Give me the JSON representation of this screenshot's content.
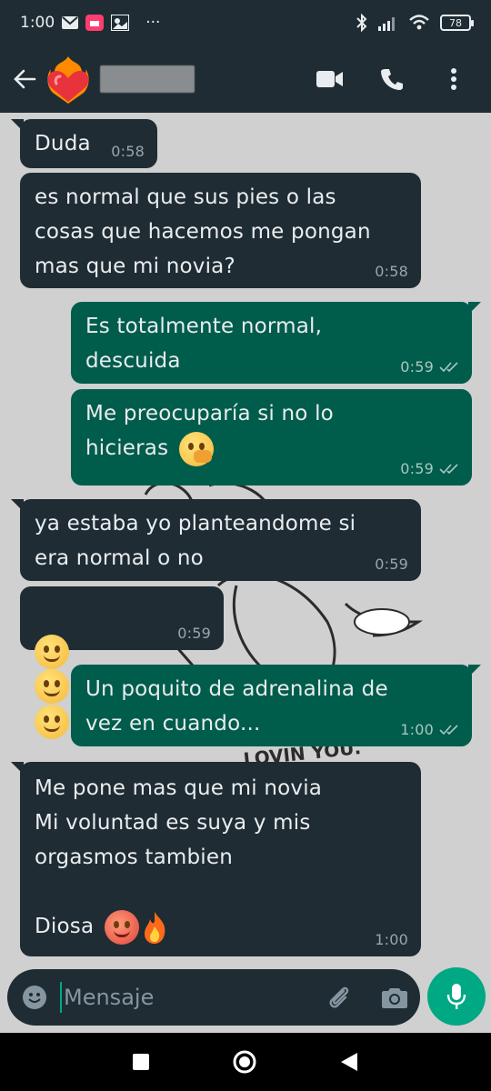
{
  "status_bar": {
    "time": "1:00",
    "overflow": "···",
    "battery": "78",
    "icons": [
      "mail-icon",
      "app-notification-icon",
      "photo-icon",
      "bluetooth-icon",
      "signal-icon",
      "wifi-icon",
      "battery-icon"
    ]
  },
  "header": {
    "avatar_icon": "heart-on-fire-icon",
    "contact_name": "",
    "actions": [
      "video-call-icon",
      "voice-call-icon",
      "more-options-icon"
    ]
  },
  "messages": [
    {
      "direction": "in",
      "text": "Duda",
      "time": "0:58"
    },
    {
      "direction": "in",
      "text": "es normal que sus pies o las\ncosas que hacemos me pongan\nmas que mi novia?",
      "time": "0:58"
    },
    {
      "direction": "out",
      "text": "Es totalmente normal,\ndescuida",
      "time": "0:59",
      "status": "read"
    },
    {
      "direction": "out",
      "text": "Me preocuparía si no lo\nhicieras",
      "emoji": "face-with-hand-over-mouth",
      "time": "0:59",
      "status": "read"
    },
    {
      "direction": "in",
      "text": "ya estaba yo planteandome si\nera normal o no",
      "time": "0:59"
    },
    {
      "direction": "in",
      "text": "",
      "emoji": "melting-face ×3",
      "time": "0:59"
    },
    {
      "direction": "out",
      "text": "Un poquito de adrenalina de\nvez en cuando...",
      "time": "1:00",
      "status": "read"
    },
    {
      "direction": "in",
      "text": "Me pone mas que mi novia\nMi voluntad es suya y mis\norgasmos tambien\n\nDiosa",
      "emoji": "hot-face, fire",
      "time": "1:00"
    }
  ],
  "wallpaper_text": "LOVIN YOU.",
  "composer": {
    "placeholder": "Mensaje",
    "icons": [
      "emoji-icon",
      "attach-icon",
      "camera-icon"
    ],
    "send_icon": "microphone-icon"
  },
  "nav": [
    "recents-square-icon",
    "home-circle-icon",
    "back-triangle-icon"
  ],
  "colors": {
    "bar": "#1f2c33",
    "incoming": "#1f2c33",
    "outgoing": "#005c4b",
    "accent": "#00a884",
    "wallpaper": "#cfd0cf"
  }
}
